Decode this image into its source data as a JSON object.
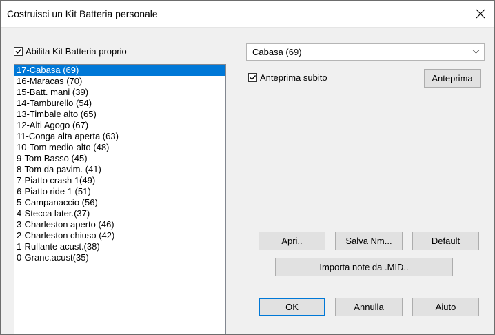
{
  "title": "Costruisci un Kit Batteria personale",
  "enable_custom_kit": {
    "label": "Abilita Kit Batteria proprio",
    "checked": true
  },
  "drum_list": {
    "selected_index": 0,
    "items": [
      "17-Cabasa (69)",
      "16-Maracas (70)",
      "15-Batt. mani (39)",
      "14-Tamburello (54)",
      "13-Timbale alto (65)",
      "12-Alti Agogo (67)",
      "11-Conga alta aperta (63)",
      "10-Tom medio-alto (48)",
      "9-Tom Basso (45)",
      "8-Tom da pavim. (41)",
      "7-Piatto crash 1(49)",
      "6-Piatto ride 1 (51)",
      "5-Campanaccio (56)",
      "4-Stecca later.(37)",
      "3-Charleston aperto (46)",
      "2-Charleston chiuso (42)",
      "1-Rullante acust.(38)",
      "0-Granc.acust(35)"
    ]
  },
  "instrument_select": {
    "value": "Cabasa (69)"
  },
  "preview_now": {
    "label": "Anteprima subito",
    "checked": true
  },
  "buttons": {
    "preview": "Anteprima",
    "open": "Apri..",
    "save_as": "Salva Nm...",
    "default": "Default",
    "import_midi": "Importa note da .MID..",
    "ok": "OK",
    "cancel": "Annulla",
    "help": "Aiuto"
  },
  "colors": {
    "selection": "#0078d7",
    "dialog_bg": "#f0f0f0",
    "button_bg": "#e1e1e1"
  },
  "icons": {
    "close": "close-icon",
    "dropdown": "chevron-down-icon",
    "check": "checkmark-icon"
  }
}
